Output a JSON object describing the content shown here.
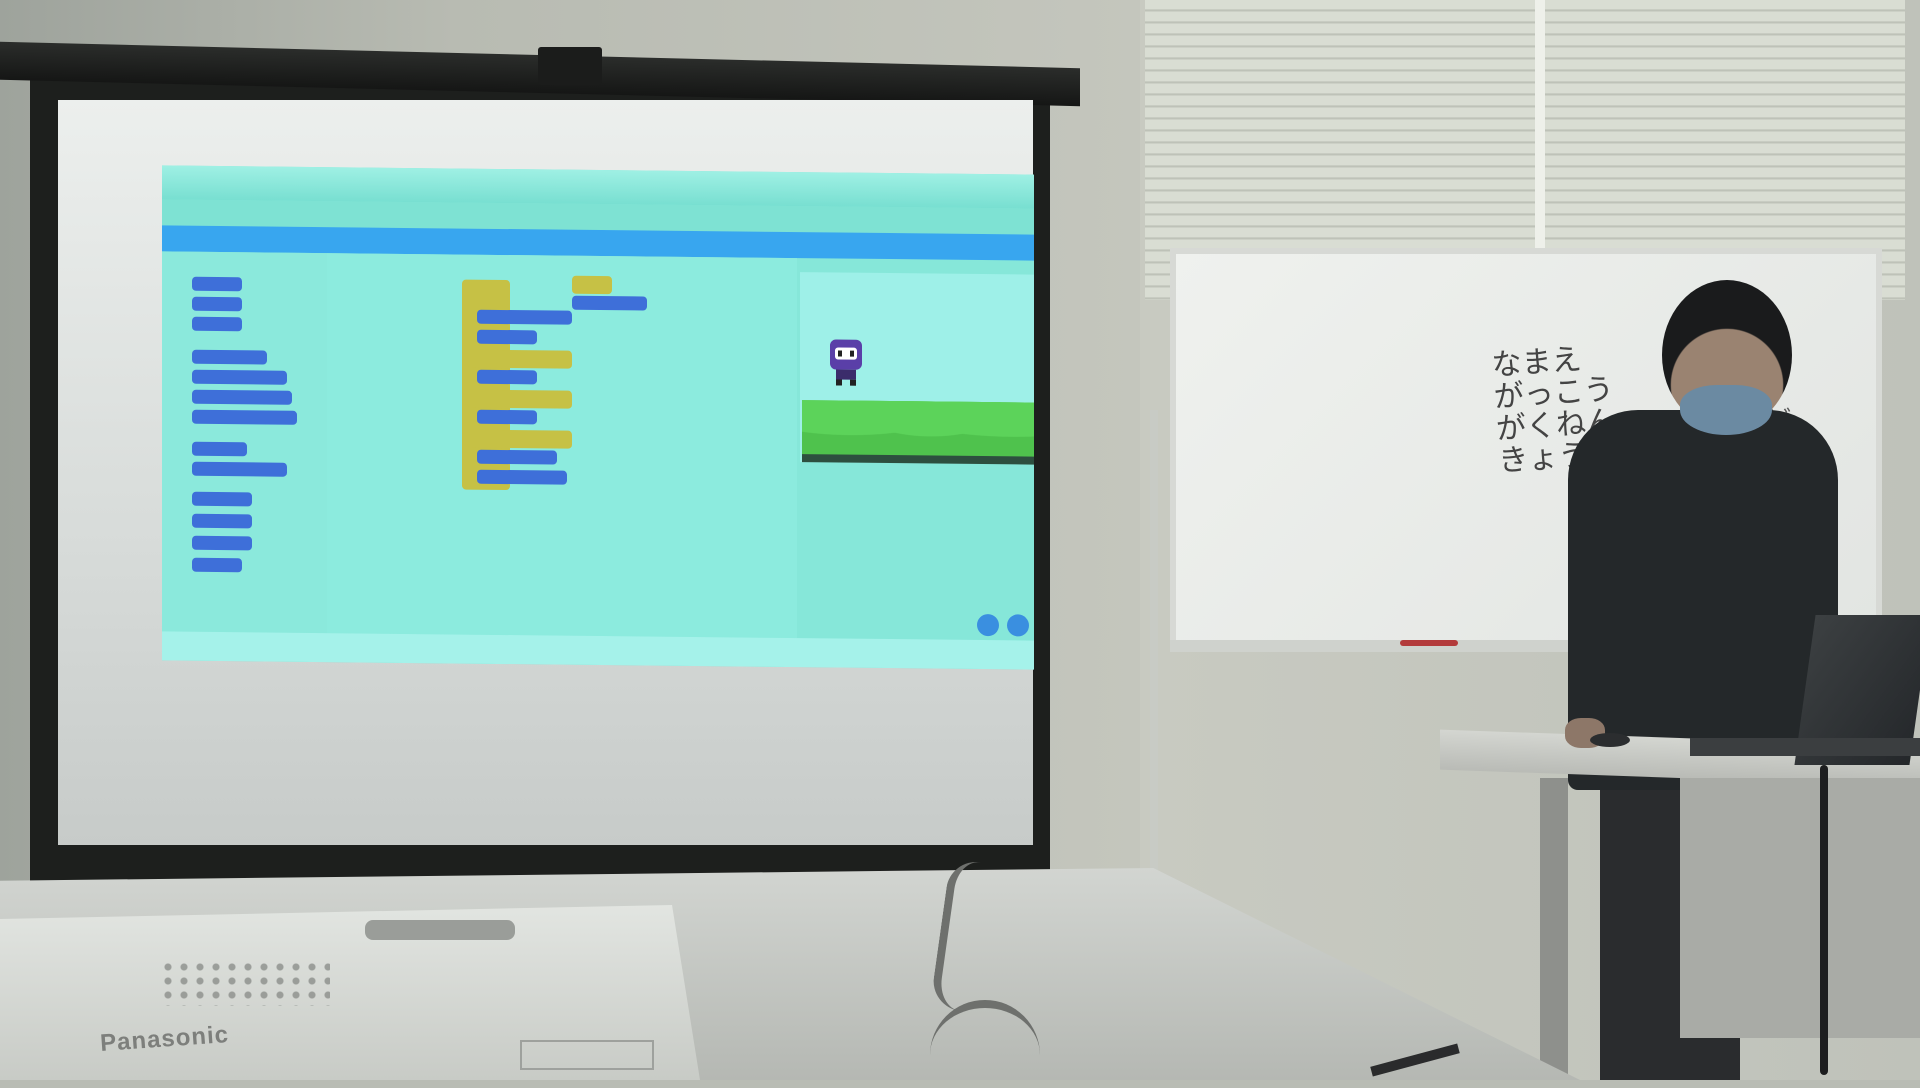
{
  "scene": {
    "description_tags": [
      "classroom",
      "projection-screen",
      "whiteboard",
      "student",
      "laptop",
      "projector"
    ]
  },
  "whiteboard": {
    "lines": [
      "なまえ",
      "がっこう",
      "がくねん",
      "きょうつく"
    ],
    "side_text": "どう"
  },
  "projector": {
    "brand": "Panasonic"
  }
}
